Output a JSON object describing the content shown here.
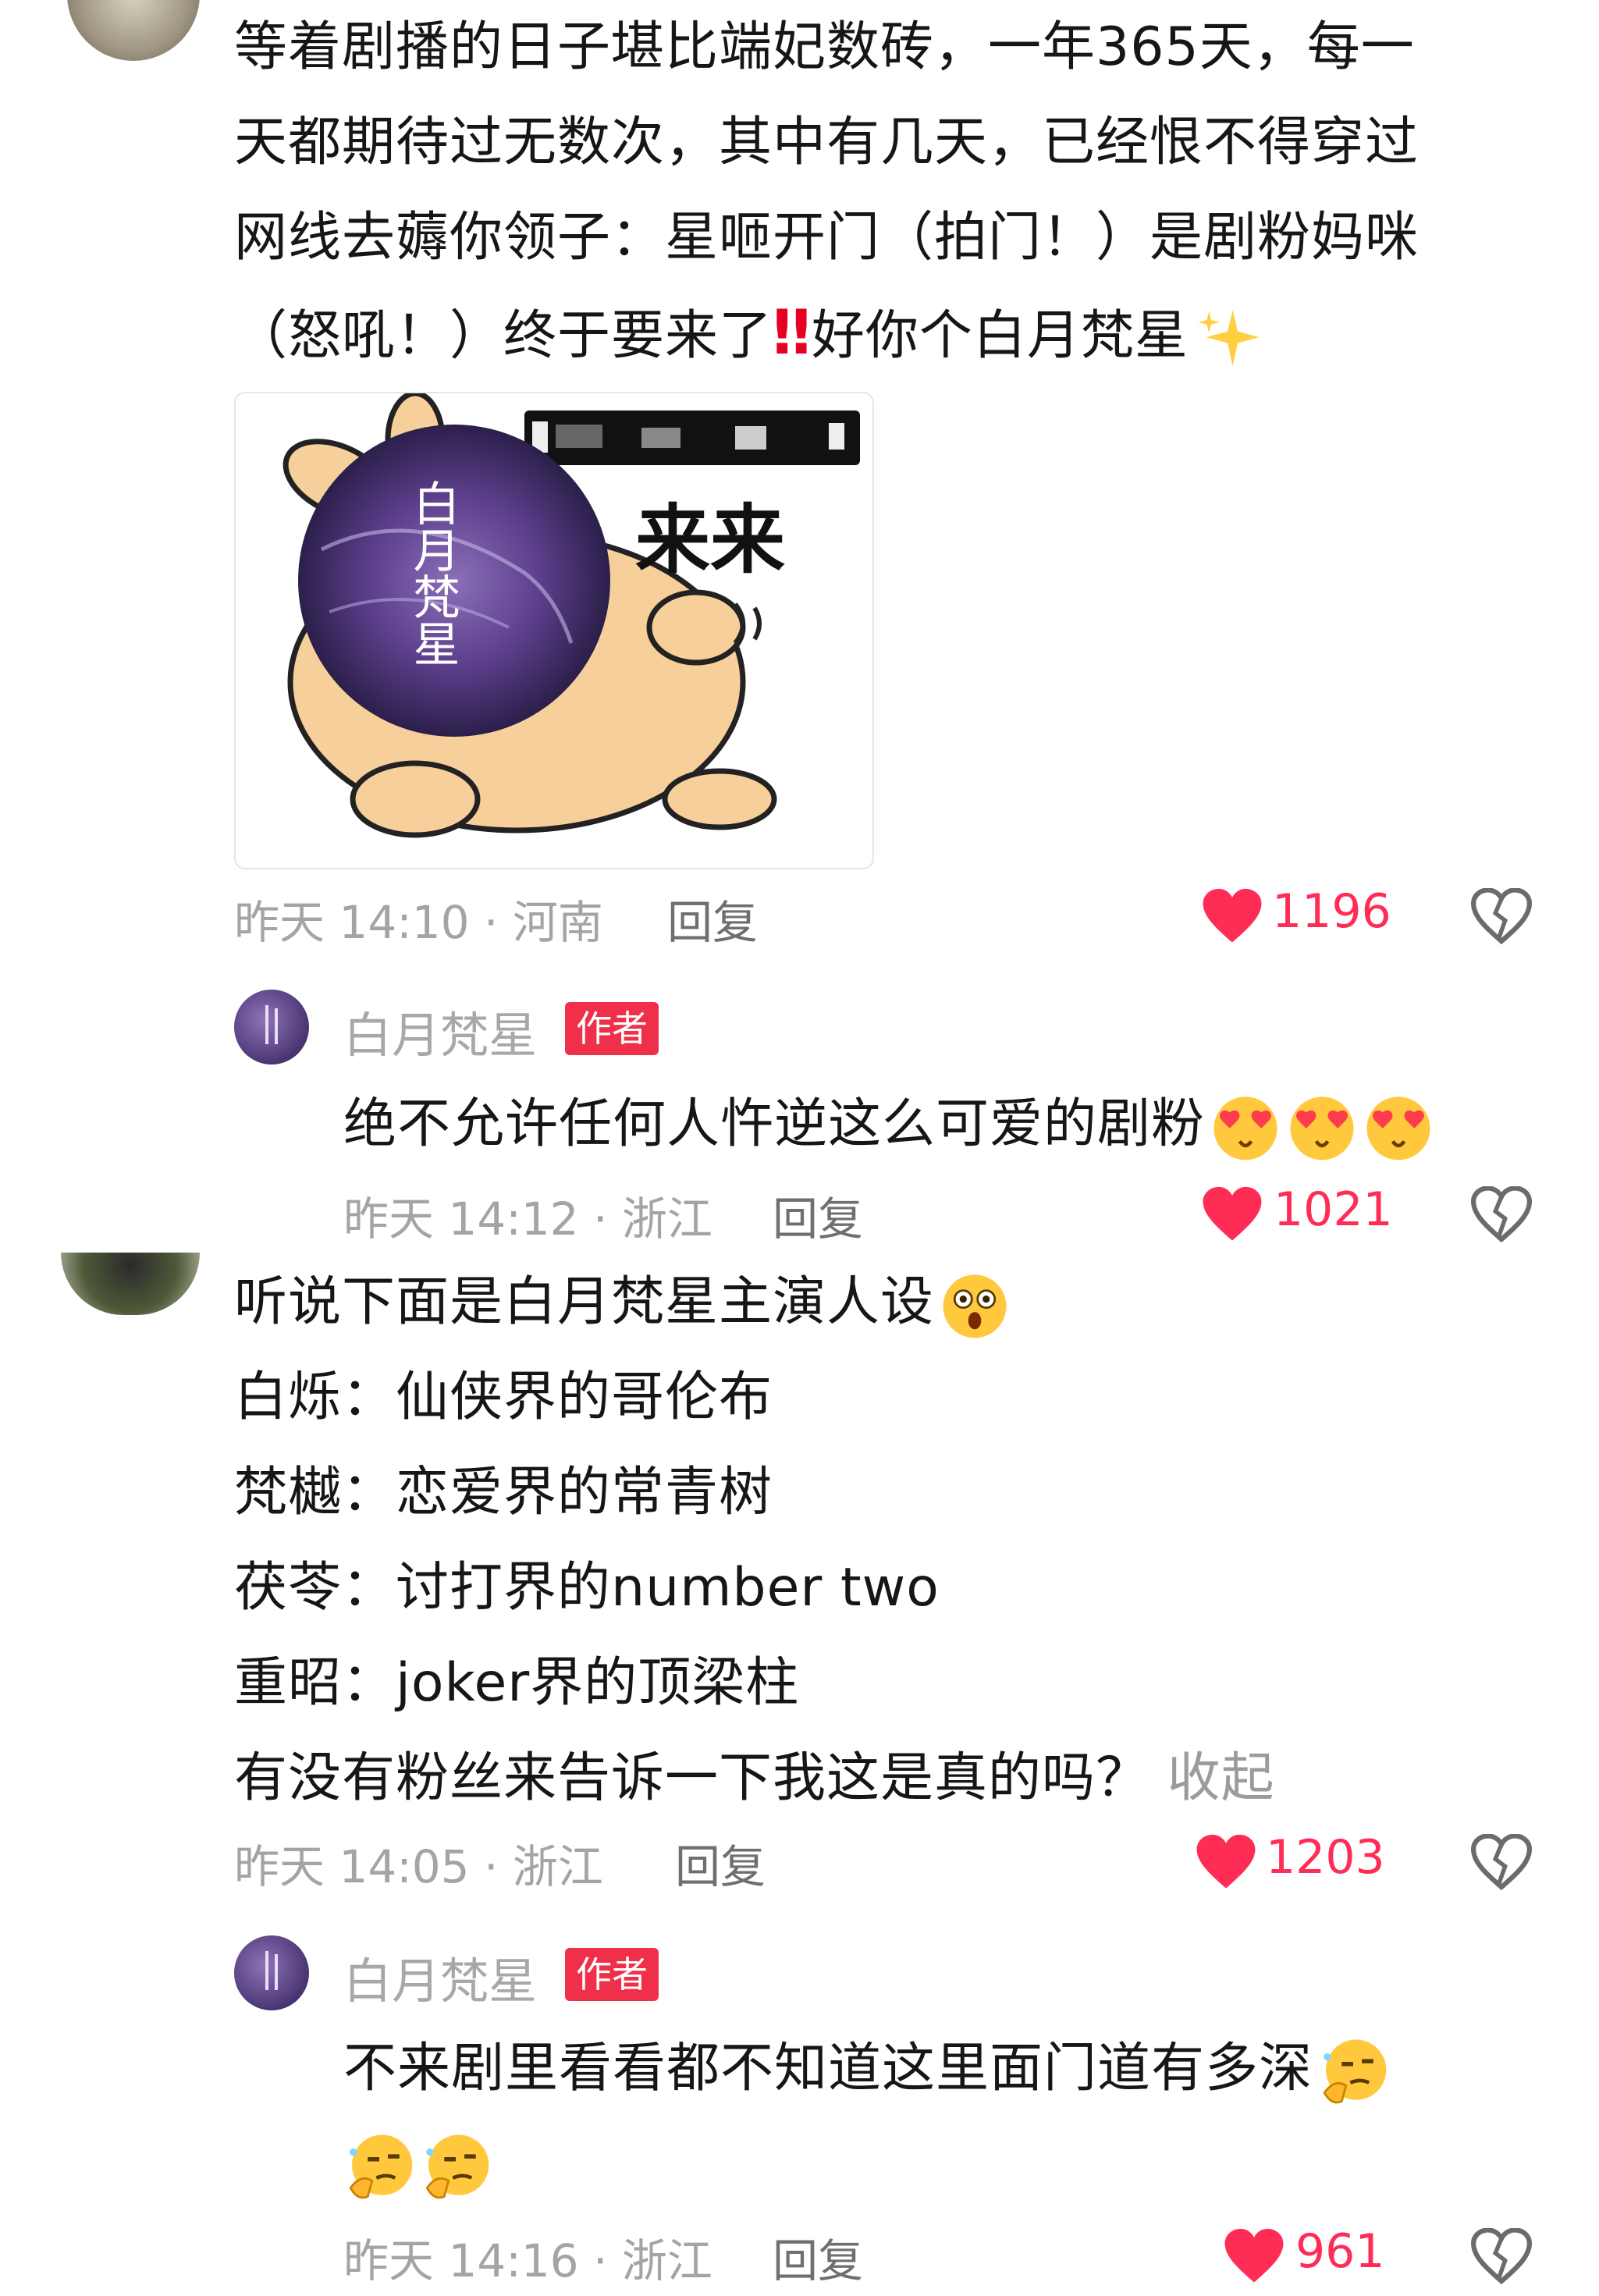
{
  "comments": [
    {
      "lines": [
        "等着剧播的日子堪比端妃数砖，一年365天，每一",
        "天都期待过无数次，其中有几天，已经恨不得穿过",
        "网线去薅你领子：星咂开门（拍门！）是剧粉妈咪",
        "（怒吼！）终于要来了"
      ],
      "line4_exclaim": "‼",
      "line4_tail": "好你个白月梵星",
      "sticker_text": "来来",
      "sticker_circle_text": "白月梵星",
      "time": "昨天 14:10 · 河南",
      "reply_label": "回复",
      "likes": "1196",
      "reply": {
        "author": "白月梵星",
        "badge": "作者",
        "text": "绝不允许任何人忤逆这么可爱的剧粉",
        "time": "昨天 14:12 · 浙江",
        "reply_label": "回复",
        "likes": "1021"
      }
    },
    {
      "lines": [
        "听说下面是白月梵星主演人设",
        "白烁：仙侠界的哥伦布",
        "梵樾：恋爱界的常青树",
        "茯苓：讨打界的number two",
        "重昭：joker界的顶梁柱",
        "有没有粉丝来告诉一下我这是真的吗？"
      ],
      "collapse_label": "收起",
      "time": "昨天 14:05 · 浙江",
      "reply_label": "回复",
      "likes": "1203",
      "reply": {
        "author": "白月梵星",
        "badge": "作者",
        "text": "不来剧里看看都不知道这里面门道有多深",
        "time": "昨天 14:16 · 浙江",
        "reply_label": "回复",
        "likes": "961"
      }
    }
  ],
  "colors": {
    "like_red": "#ff2d55",
    "badge_red": "#f0304a",
    "meta_gray": "#a4a4a4"
  },
  "icons": {
    "like": "heart-icon",
    "dislike": "broken-heart-icon"
  }
}
